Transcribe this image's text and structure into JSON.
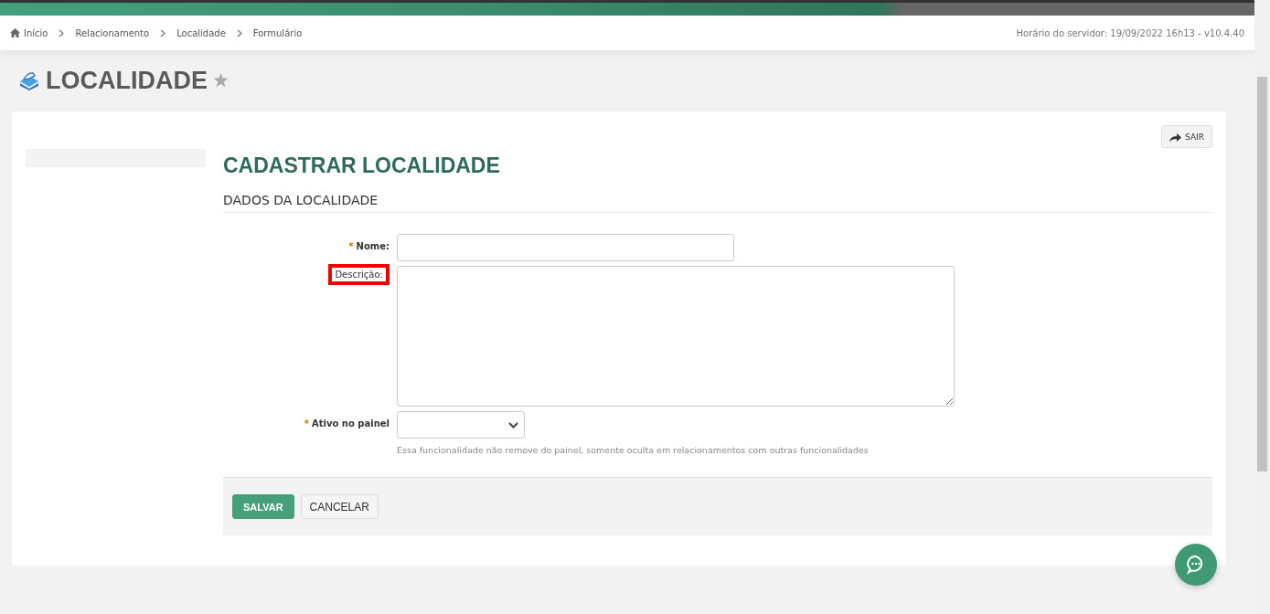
{
  "breadcrumb": [
    {
      "label": "Início",
      "kind": "home"
    },
    {
      "label": "Relacionamento",
      "kind": "link"
    },
    {
      "label": "Localidade",
      "kind": "link"
    },
    {
      "label": "Formulário",
      "kind": "link"
    }
  ],
  "server_info": "Horário do servidor: 19/09/2022 16h13 - v10.4.40",
  "page_title": "LOCALIDADE",
  "favorite": false,
  "exit_button": "SAIR",
  "form_title": "CADASTRAR LOCALIDADE",
  "section_title": "DADOS DA LOCALIDADE",
  "fields": [
    {
      "kind": "text",
      "label": "Nome:",
      "required": true,
      "highlighted": false
    },
    {
      "kind": "textarea",
      "label": "Descrição:",
      "required": false,
      "highlighted": true
    },
    {
      "kind": "select",
      "label": "Ativo no painel",
      "required": true,
      "highlighted": false,
      "hint": "Essa funcionalidade não remove do painel, somente oculta em relacionamentos com outras funcionalidades"
    }
  ],
  "required_mark": "*",
  "buttons": [
    {
      "label": "SALVAR",
      "kind": "primary"
    },
    {
      "label": "CANCELAR",
      "kind": "default"
    }
  ]
}
